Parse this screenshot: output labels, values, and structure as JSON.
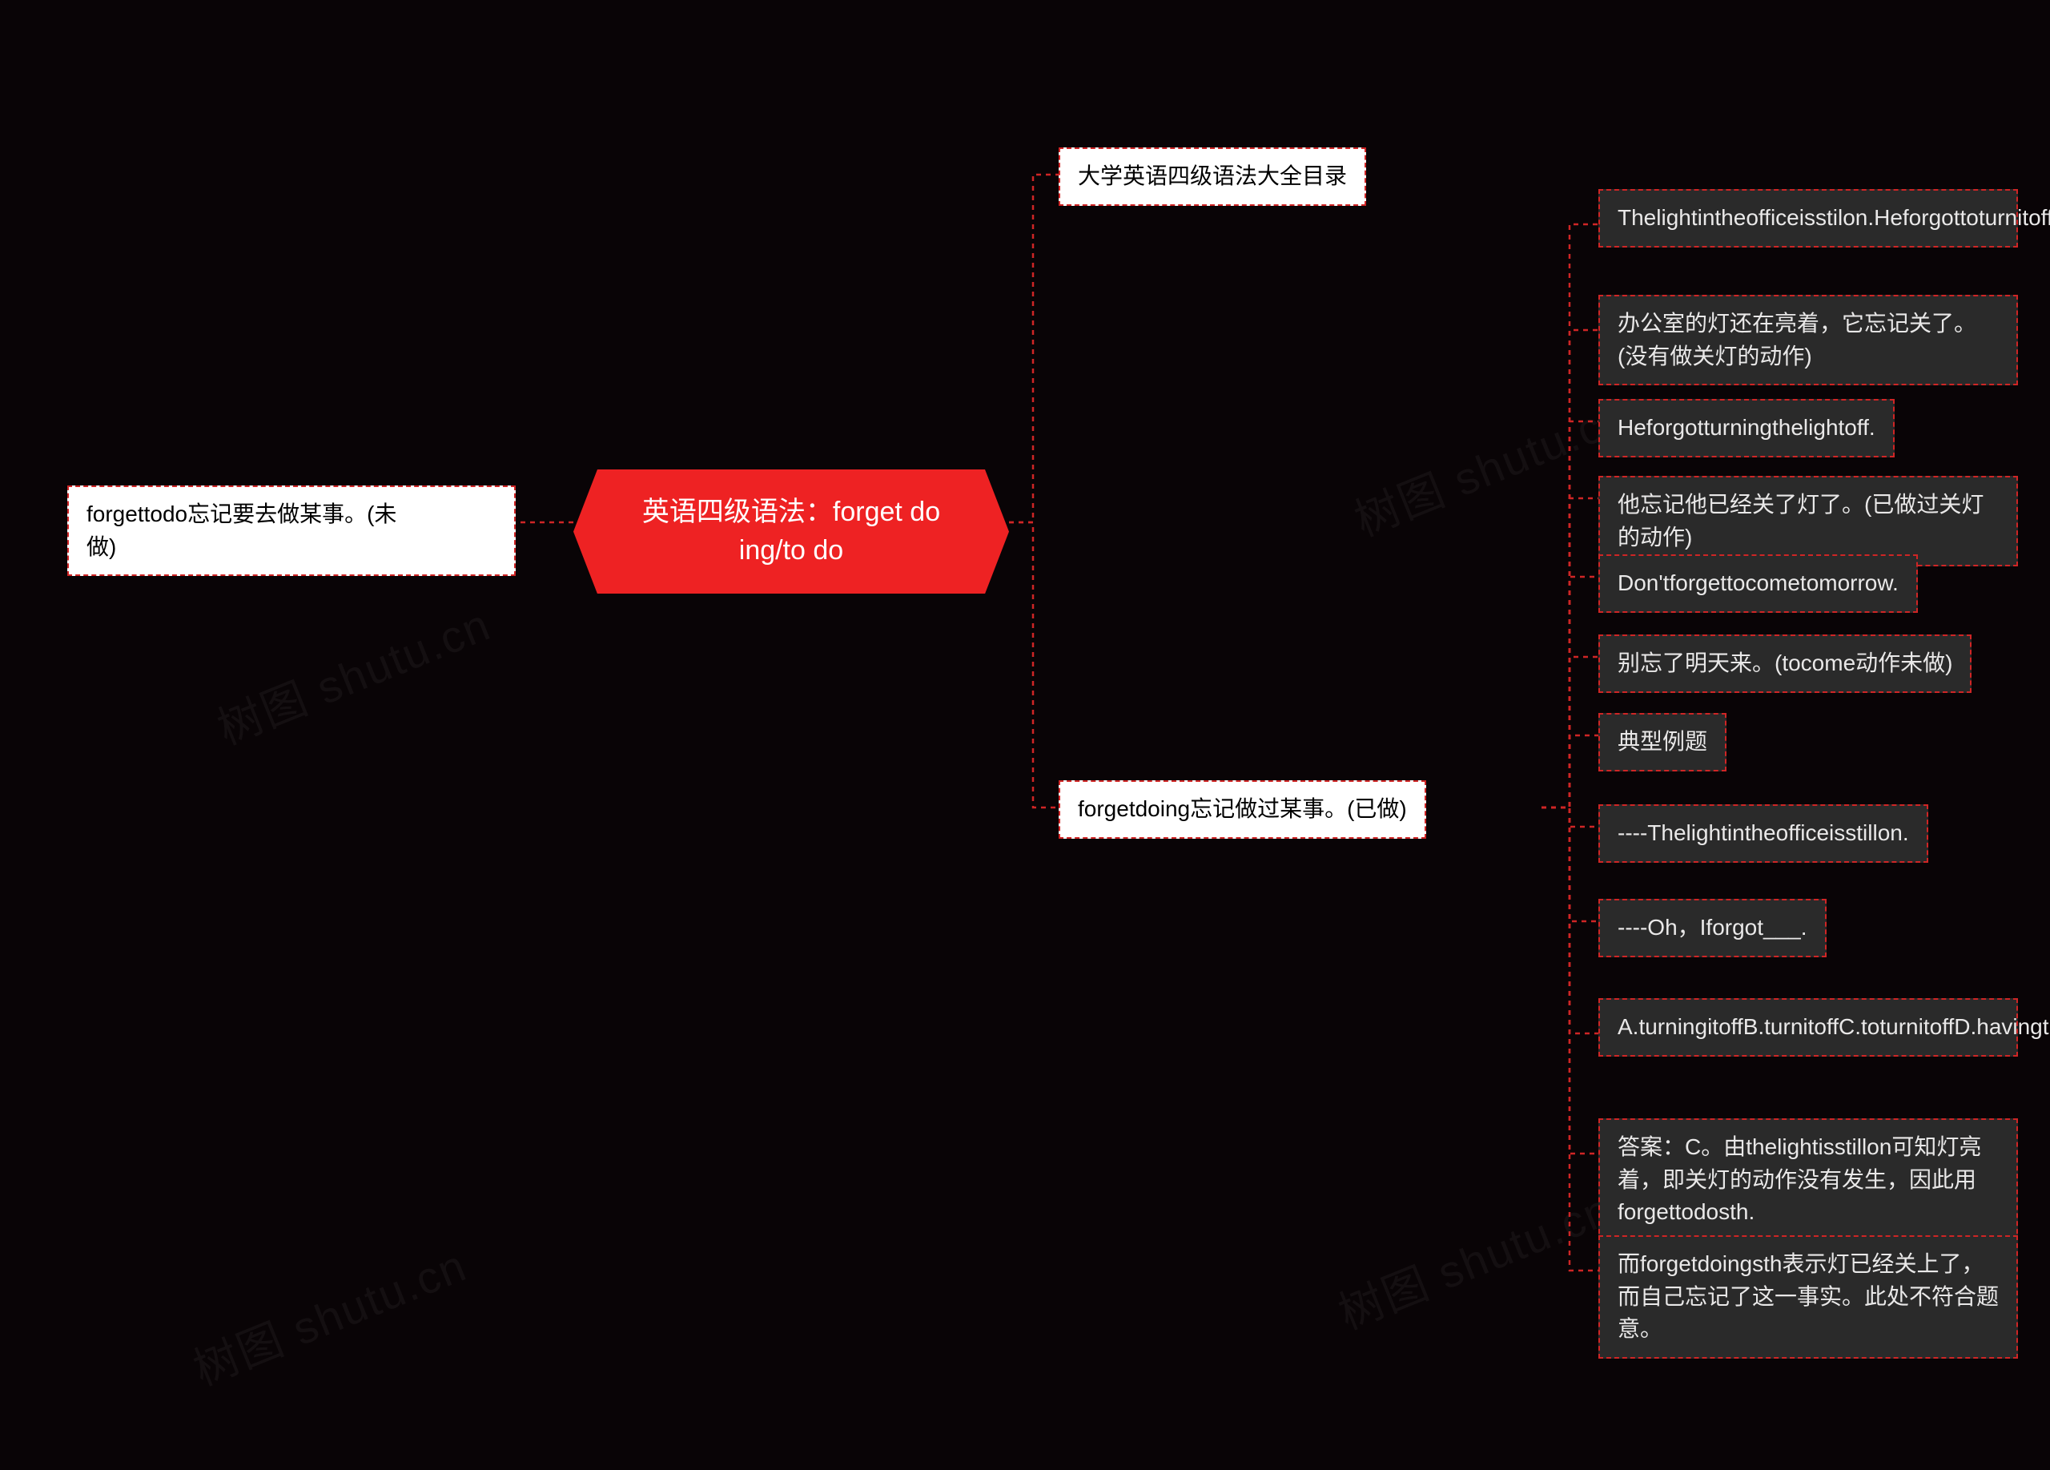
{
  "watermark": "树图 shutu.cn",
  "root": {
    "line1": "英语四级语法：forget do",
    "line2": "ing/to do"
  },
  "left1": {
    "line1": "forgettodo忘记要去做某事。(未",
    "line2": "做)"
  },
  "rightTop": "大学英语四级语法大全目录",
  "rightBottom": "forgetdoing忘记做过某事。(已做)",
  "leaves": [
    "Thelightintheofficeisstilon.Heforgottoturnitoff.",
    "办公室的灯还在亮着，它忘记关了。(没有做关灯的动作)",
    "Heforgotturningthelightoff.",
    "他忘记他已经关了灯了。(已做过关灯的动作)",
    "Don'tforgettocometomorrow.",
    "别忘了明天来。(tocome动作未做)",
    "典型例题",
    "----Thelightintheofficeisstillon.",
    "----Oh，Iforgot___.",
    "A.turningitoffB.turnitoffC.toturnitoffD.havingturneditoff",
    "答案：C。由thelightisstillon可知灯亮着，即关灯的动作没有发生，因此用forgettodosth.",
    "而forgetdoingsth表示灯已经关上了，而自己忘记了这一事实。此处不符合题意。"
  ],
  "chart_data": {
    "type": "mindmap",
    "root": "英语四级语法：forget doing/to do",
    "children": [
      {
        "label": "forgettodo忘记要去做某事。(未做)",
        "side": "left"
      },
      {
        "label": "大学英语四级语法大全目录",
        "side": "right"
      },
      {
        "label": "forgetdoing忘记做过某事。(已做)",
        "side": "right",
        "children": [
          "Thelightintheofficeisstilon.Heforgottoturnitoff.",
          "办公室的灯还在亮着，它忘记关了。(没有做关灯的动作)",
          "Heforgotturningthelightoff.",
          "他忘记他已经关了灯了。(已做过关灯的动作)",
          "Don'tforgettocometomorrow.",
          "别忘了明天来。(tocome动作未做)",
          "典型例题",
          "----Thelightintheofficeisstillon.",
          "----Oh，Iforgot___.",
          "A.turningitoffB.turnitoffC.toturnitoffD.havingturneditoff",
          "答案：C。由thelightisstillon可知灯亮着，即关灯的动作没有发生，因此用forgettodosth.",
          "而forgetdoingsth表示灯已经关上了，而自己忘记了这一事实。此处不符合题意。"
        ]
      }
    ]
  }
}
